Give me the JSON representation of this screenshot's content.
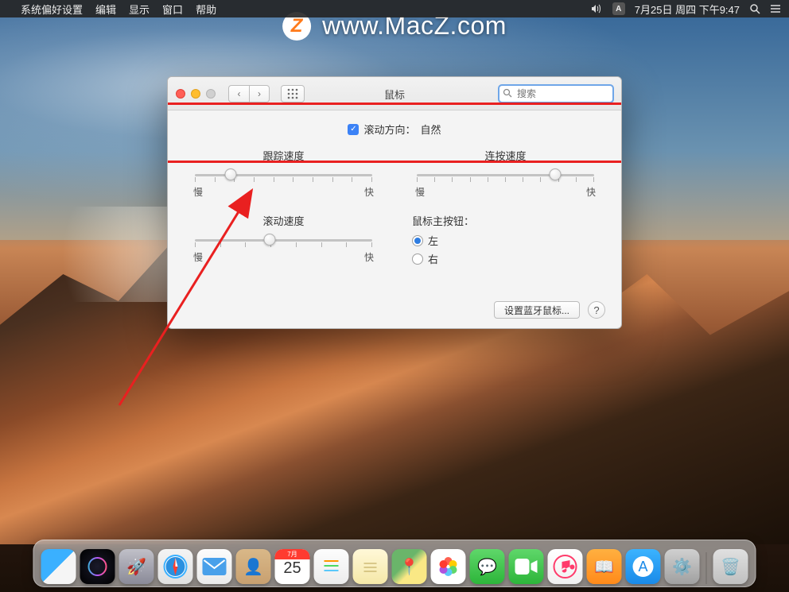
{
  "menubar": {
    "app": "系统偏好设置",
    "items": [
      "编辑",
      "显示",
      "窗口",
      "帮助"
    ],
    "date": "7月25日 周四 下午9:47",
    "input_source": "A"
  },
  "watermark": {
    "logo": "Z",
    "text": "www.MacZ.com"
  },
  "window": {
    "title": "鼠标",
    "search_placeholder": "搜索",
    "scroll_direction_label": "滚动方向：",
    "scroll_direction_value": "自然",
    "tracking": {
      "label": "跟踪速度",
      "min": "慢",
      "max": "快",
      "value_pct": 20,
      "ticks": 10
    },
    "doubleclick": {
      "label": "连按速度",
      "min": "慢",
      "max": "快",
      "value_pct": 78,
      "ticks": 11
    },
    "scrolling": {
      "label": "滚动速度",
      "min": "慢",
      "max": "快",
      "value_pct": 42,
      "ticks": 8
    },
    "primary_button": {
      "label": "鼠标主按钮：",
      "left": "左",
      "right": "右",
      "selected": "left"
    },
    "bluetooth_button": "设置蓝牙鼠标...",
    "help": "?"
  },
  "dock": {
    "calendar": {
      "month": "7月",
      "day": "25"
    },
    "items": [
      "finder",
      "siri",
      "launchpad",
      "safari",
      "mail",
      "contacts",
      "calendar",
      "reminders",
      "notes",
      "maps",
      "photos",
      "messages",
      "facetime",
      "itunes",
      "ibooks",
      "appstore",
      "sysprefs"
    ]
  }
}
